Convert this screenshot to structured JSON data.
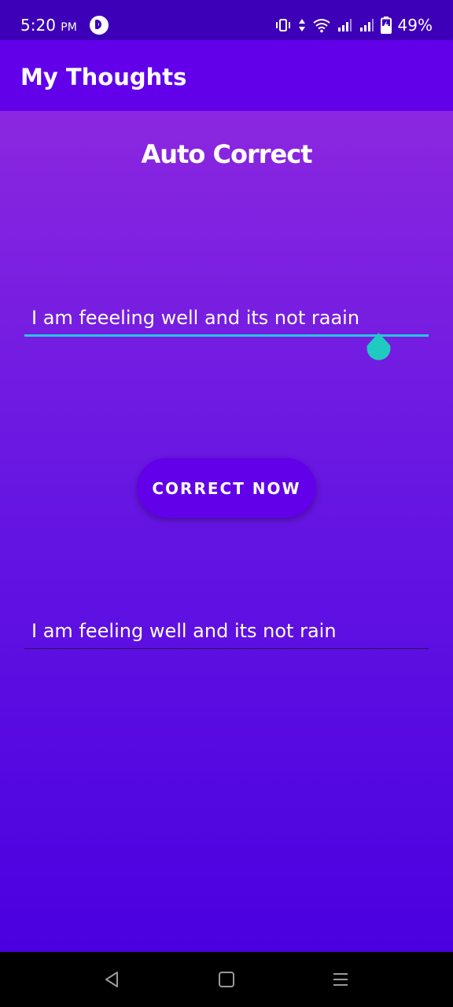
{
  "status_bar": {
    "time": "5:20",
    "ampm": "PM",
    "battery_percent": "49%",
    "icons": [
      "app-notification-icon",
      "vibrate-icon",
      "data-arrows-icon",
      "wifi-icon",
      "signal-icon",
      "signal-icon",
      "battery-charging-icon"
    ]
  },
  "app_bar": {
    "title": "My Thoughts"
  },
  "main": {
    "heading": "Auto Correct",
    "input_text": "I am feeeling well and its not raain",
    "button_label": "CORRECT NOW",
    "output_text": "I am feeling well and its not rain"
  },
  "nav_bar": {
    "buttons": [
      "back-icon",
      "home-icon",
      "menu-icon"
    ]
  },
  "colors": {
    "status_bar": "#3d00b8",
    "app_bar": "#6200ea",
    "gradient_top": "#8b27e0",
    "gradient_bottom": "#4a00e0",
    "accent": "#26c6da",
    "button": "#6200ea"
  }
}
